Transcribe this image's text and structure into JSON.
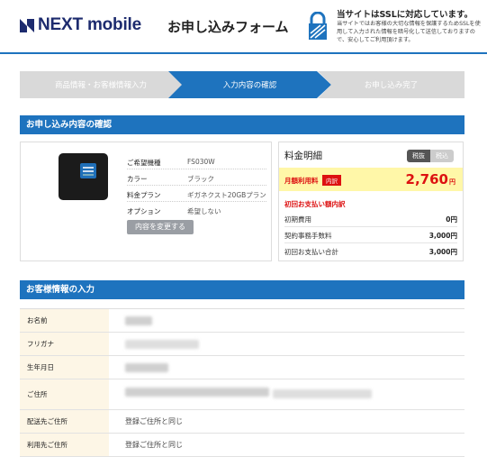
{
  "header": {
    "logo_text": "NEXT mobile",
    "page_title": "お申し込みフォーム",
    "ssl_title": "当サイトはSSLに対応しています。",
    "ssl_description": "当サイトではお客様の大切な情報を保護するためSSLを使用して入力された情報を暗号化して送信しておりますので、安心してご利用頂けます。"
  },
  "steps": [
    {
      "label": "商品情報・お客様情報入力",
      "state": "done"
    },
    {
      "label": "入力内容の確認",
      "state": "active"
    },
    {
      "label": "お申し込み完了",
      "state": "pending"
    }
  ],
  "order_section": {
    "title": "お申し込み内容の確認",
    "specs": [
      {
        "label": "ご希望機種",
        "value": "FS030W"
      },
      {
        "label": "カラー",
        "value": "ブラック"
      },
      {
        "label": "料金プラン",
        "value": "ギガネクスト20GBプラン"
      },
      {
        "label": "オプション",
        "value": "希望しない"
      }
    ],
    "change_button": "内容を変更する"
  },
  "fee": {
    "title": "料金明細",
    "tax_excluded": "税抜",
    "tax_included": "税込",
    "monthly_label": "月額利用料",
    "monthly_badge": "内訳",
    "monthly_price": "2,760",
    "yen": "円",
    "initial_heading": "初回お支払い額内訳",
    "rows": [
      {
        "label": "初期費用",
        "value": "0円"
      },
      {
        "label": "契約事務手数料",
        "value": "3,000円"
      },
      {
        "label": "初回お支払い合計",
        "value": "3,000円"
      }
    ]
  },
  "customer_section": {
    "title": "お客様情報の入力",
    "rows": [
      {
        "label": "お名前",
        "value": ""
      },
      {
        "label": "フリガナ",
        "value": ""
      },
      {
        "label": "生年月日",
        "value": ""
      },
      {
        "label": "ご住所",
        "value": ""
      },
      {
        "label": "配送先ご住所",
        "value": "登録ご住所と同じ"
      },
      {
        "label": "利用先ご住所",
        "value": "登録ご住所と同じ"
      }
    ]
  },
  "colors": {
    "brand_blue": "#1e73be",
    "logo_navy": "#1d2b6e",
    "price_red": "#dd1111",
    "highlight_yellow": "#fff7a8"
  }
}
